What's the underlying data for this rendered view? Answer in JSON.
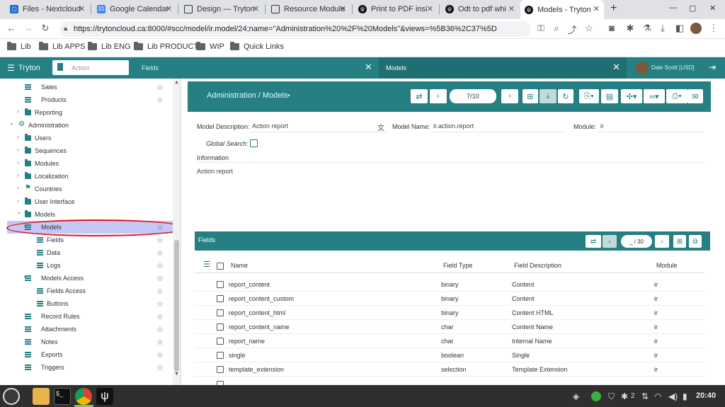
{
  "browser": {
    "tabs": [
      {
        "title": "Files - Nextcloud",
        "favicon_color": "#1e6bd6"
      },
      {
        "title": "Google Calendar",
        "favicon_color": "#4285f4"
      },
      {
        "title": "Design — Tryton",
        "favicon_color": "#333333"
      },
      {
        "title": "Resource Module",
        "favicon_color": "#333333"
      },
      {
        "title": "Print to PDF insi",
        "favicon_color": "#111111"
      },
      {
        "title": "Odt to pdf whi",
        "favicon_color": "#111111"
      },
      {
        "title": "Models - Tryton",
        "favicon_color": "#111111"
      }
    ],
    "new_tab": "+",
    "url": "https://trytoncloud.ca:8000/#scc/model/ir.model/24;name=\"Administration%20%2F%20Models\"&views=%5B36%2C37%5D",
    "bookmarks": [
      "Lib",
      "Lib APPS",
      "Lib ENG",
      "Lib PRODUCT",
      "WIP",
      "Quick Links"
    ]
  },
  "app": {
    "brand": "Tryton",
    "search_placeholder": "Action",
    "fields_label": "Fields",
    "tab_models": "Models",
    "user": "Dale Scott [USD]"
  },
  "menu": [
    {
      "label": "Sales",
      "icon": "list-icon",
      "level": 2,
      "star": true
    },
    {
      "label": "Products",
      "icon": "list-icon",
      "level": 2,
      "star": true
    },
    {
      "label": "Reporting",
      "icon": "folder-icon",
      "level": 1,
      "chev": "›",
      "star": false
    },
    {
      "label": "Administration",
      "icon": "gear-icon",
      "level": 0,
      "chev": "⌄",
      "star": false
    },
    {
      "label": "Users",
      "icon": "folder-icon",
      "level": 1,
      "chev": "›",
      "star": false
    },
    {
      "label": "Sequences",
      "icon": "folder-icon",
      "level": 1,
      "chev": "›",
      "star": false
    },
    {
      "label": "Modules",
      "icon": "folder-icon",
      "level": 1,
      "chev": "›",
      "star": false
    },
    {
      "label": "Localization",
      "icon": "folder-icon",
      "level": 1,
      "chev": "›",
      "star": false
    },
    {
      "label": "Countries",
      "icon": "flag-icon",
      "level": 1,
      "chev": "›",
      "star": false
    },
    {
      "label": "User Interface",
      "icon": "folder-icon",
      "level": 1,
      "chev": "›",
      "star": false
    },
    {
      "label": "Models",
      "icon": "folder-icon",
      "level": 1,
      "chev": "⌄",
      "star": false
    },
    {
      "label": "Models",
      "icon": "list-icon",
      "level": 2,
      "chev": "⌄",
      "star": true,
      "selected": true
    },
    {
      "label": "Fields",
      "icon": "list-icon",
      "level": 3,
      "star": true
    },
    {
      "label": "Data",
      "icon": "list-icon",
      "level": 3,
      "star": true
    },
    {
      "label": "Logs",
      "icon": "list-icon",
      "level": 3,
      "star": true
    },
    {
      "label": "Models Access",
      "icon": "list-icon",
      "level": 2,
      "chev": "⌄",
      "star": true
    },
    {
      "label": "Fields Access",
      "icon": "list-icon",
      "level": 3,
      "star": true
    },
    {
      "label": "Buttons",
      "icon": "list-icon",
      "level": 3,
      "star": true
    },
    {
      "label": "Record Rules",
      "icon": "list-icon",
      "level": 2,
      "star": true
    },
    {
      "label": "Attachments",
      "icon": "list-icon",
      "level": 2,
      "star": true
    },
    {
      "label": "Notes",
      "icon": "list-icon",
      "level": 2,
      "star": true
    },
    {
      "label": "Exports",
      "icon": "list-icon",
      "level": 2,
      "star": true
    },
    {
      "label": "Triggers",
      "icon": "list-icon",
      "level": 2,
      "star": true
    }
  ],
  "form": {
    "breadcrumb": "Administration / Models",
    "record_position": "7/10",
    "model_description_label": "Model Description:",
    "model_description_value": "Action report",
    "model_name_label": "Model Name:",
    "model_name_value": "ir.action.report",
    "module_label": "Module:",
    "module_value": "ir",
    "global_search_label": "Global Search:",
    "information_label": "Information",
    "information_value": "Action report"
  },
  "fields_table": {
    "title": "Fields",
    "count": "_ / 30",
    "columns": [
      "Name",
      "Field Type",
      "Field Description",
      "Module"
    ],
    "rows": [
      [
        "report_content",
        "binary",
        "Content",
        "ir"
      ],
      [
        "report_content_custom",
        "binary",
        "Content",
        "ir"
      ],
      [
        "report_content_html",
        "binary",
        "Content HTML",
        "ir"
      ],
      [
        "report_content_name",
        "char",
        "Content Name",
        "ir"
      ],
      [
        "report_name",
        "char",
        "Internal Name",
        "ir"
      ],
      [
        "single",
        "boolean",
        "Single",
        "ir"
      ],
      [
        "template_extension",
        "selection",
        "Template Extension",
        "ir"
      ]
    ]
  },
  "taskbar": {
    "clock": "20:40",
    "badge": "2"
  },
  "colors": {
    "accent": "#267f82",
    "selection": "#c7c7f5",
    "highlight_ring": "#e0141e"
  }
}
